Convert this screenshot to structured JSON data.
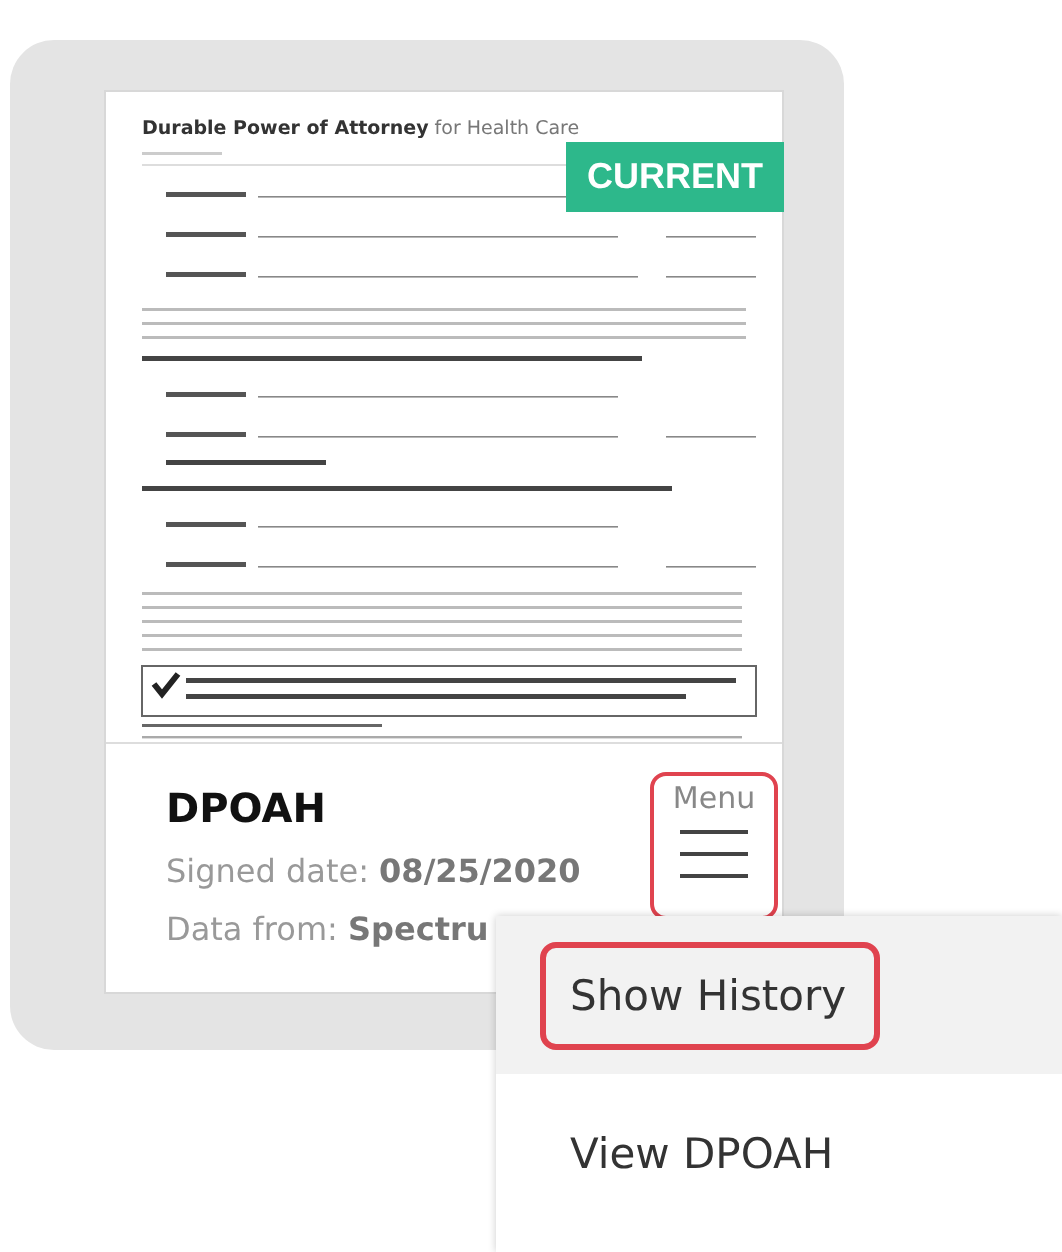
{
  "card": {
    "document_title": "**Durable Power of Attorney** for Health Care",
    "badge": "CURRENT",
    "name": "DPOAH",
    "signed": "Signed date: **08/25/2020**",
    "source": "Data from: **Spectru**"
  },
  "menu_button": {
    "label": "Menu",
    "highlighted": true
  },
  "menu": [
    {
      "label": "Show History",
      "hovered": true,
      "highlighted": true
    },
    {
      "label": "View DPOAH",
      "hovered": false,
      "highlighted": false
    }
  ]
}
